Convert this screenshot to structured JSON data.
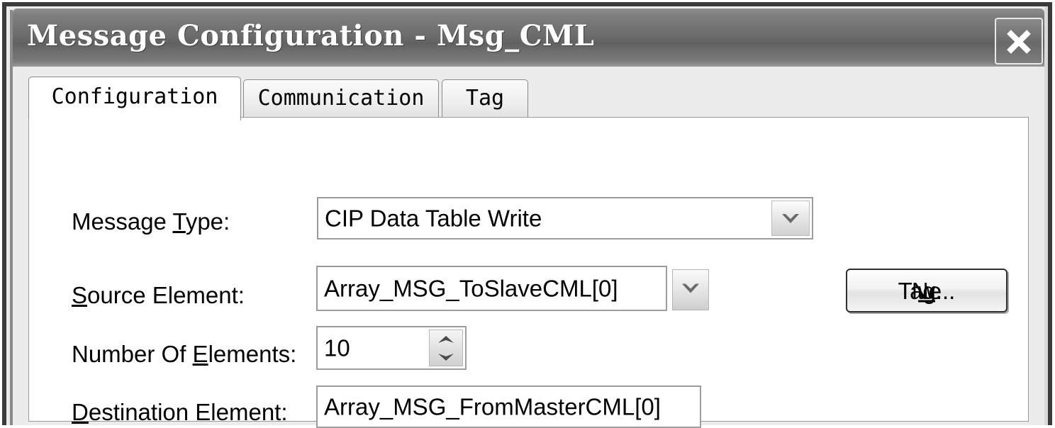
{
  "window": {
    "title": "Message Configuration - Msg_CML",
    "close_icon": "close-x-icon"
  },
  "tabs": [
    {
      "label": "Configuration",
      "active": true
    },
    {
      "label": "Communication",
      "active": false
    },
    {
      "label": "Tag",
      "active": false
    }
  ],
  "form": {
    "message_type": {
      "label_pre": "Message ",
      "label_accel": "T",
      "label_post": "ype:",
      "value": "CIP Data Table Write",
      "dropdown_icon": "chevron-down-icon"
    },
    "source_element": {
      "label_pre": "",
      "label_accel": "S",
      "label_post": "ource Element:",
      "value": "Array_MSG_ToSlaveCML[0]",
      "dropdown_icon": "chevron-down-icon"
    },
    "number_of_elements": {
      "label_pre": "Number Of ",
      "label_accel": "E",
      "label_post": "lements:",
      "value": "10",
      "up_icon": "triangle-up-icon",
      "down_icon": "triangle-down-icon"
    },
    "destination_element": {
      "label_pre": "",
      "label_accel": "D",
      "label_post": "estination Element:",
      "value": "Array_MSG_FromMasterCML[0]"
    },
    "new_tag_button": {
      "label_pre": "Ne",
      "label_accel": "w",
      "label_post": " Tag..."
    }
  },
  "colors": {
    "titlebar": "#6b6b6b",
    "dialog_face": "#ececec",
    "tabpage": "#ffffff",
    "field_border": "#9a9a9a",
    "text": "#000000"
  }
}
